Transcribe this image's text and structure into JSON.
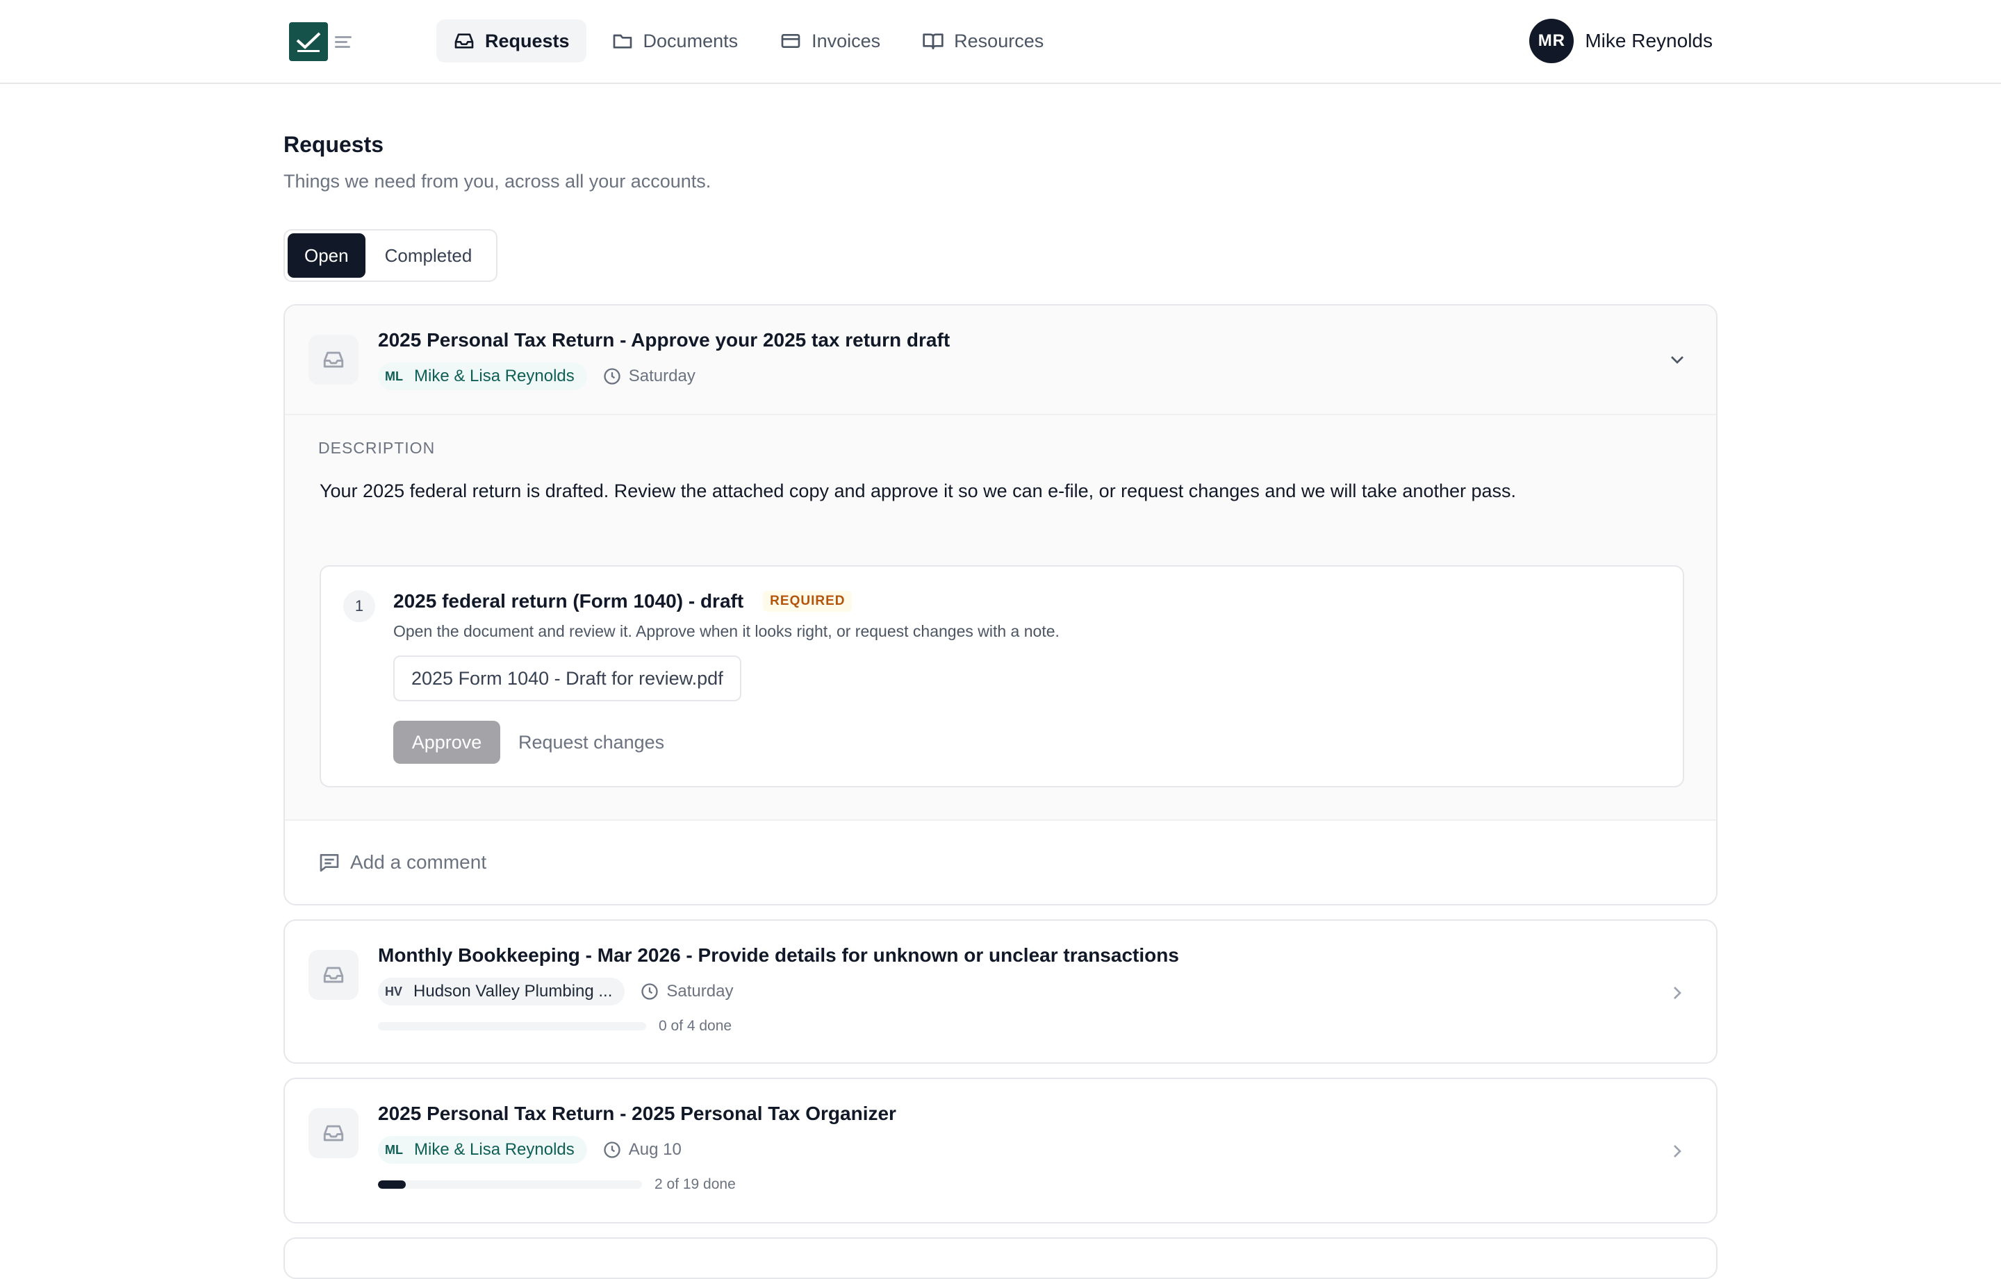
{
  "nav": {
    "items": [
      {
        "label": "Requests",
        "icon": "inbox-icon",
        "active": true
      },
      {
        "label": "Documents",
        "icon": "folder-icon",
        "active": false
      },
      {
        "label": "Invoices",
        "icon": "credit-card-icon",
        "active": false
      },
      {
        "label": "Resources",
        "icon": "book-open-icon",
        "active": false
      }
    ]
  },
  "user": {
    "initials": "MR",
    "name": "Mike Reynolds"
  },
  "page": {
    "title": "Requests",
    "subtitle": "Things we need from you, across all your accounts."
  },
  "tabs": [
    {
      "label": "Open",
      "active": true
    },
    {
      "label": "Completed",
      "active": false
    }
  ],
  "colors": {
    "brand": "#14524a",
    "dark": "#111827",
    "required_text": "#b45309",
    "account_chip_teal": "#0f5f56"
  },
  "requests": [
    {
      "title": "2025 Personal Tax Return - Approve your 2025 tax return draft",
      "account_initials": "ML",
      "account_name": "Mike & Lisa Reynolds",
      "due": "Saturday",
      "expanded": true,
      "description_label": "DESCRIPTION",
      "description": "Your 2025 federal return is drafted. Review the attached copy and approve it so we can e-file, or request changes and we will take another pass.",
      "item": {
        "number": "1",
        "title": "2025 federal return (Form 1040) - draft",
        "badge": "REQUIRED",
        "instructions": "Open the document and review it. Approve when it looks right, or request changes with a note.",
        "file_name": "2025 Form 1040 - Draft for review.pdf",
        "approve_label": "Approve",
        "request_changes_label": "Request changes"
      },
      "comment_label": "Add a comment"
    },
    {
      "title": "Monthly Bookkeeping - Mar 2026 - Provide details for unknown or unclear transactions",
      "account_initials": "HV",
      "account_name": "Hudson Valley Plumbing ...",
      "due": "Saturday",
      "progress_done": 0,
      "progress_total": 4,
      "progress_text": "0 of 4 done"
    },
    {
      "title": "2025 Personal Tax Return - 2025 Personal Tax Organizer",
      "account_initials": "ML",
      "account_name": "Mike & Lisa Reynolds",
      "due": "Aug 10",
      "progress_done": 2,
      "progress_total": 19,
      "progress_text": "2 of 19 done"
    }
  ]
}
